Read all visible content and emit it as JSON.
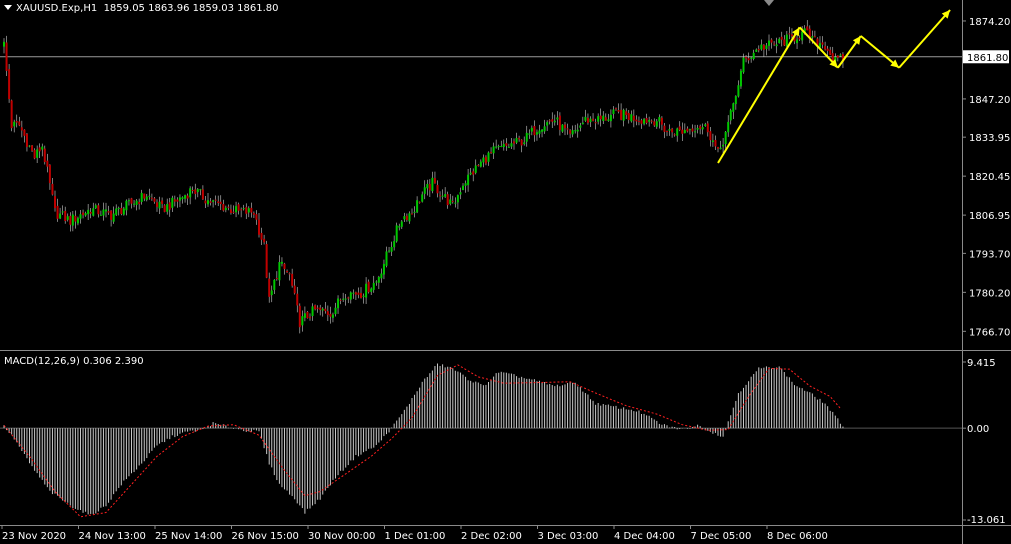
{
  "chart_header": {
    "symbol_text": "XAUUSD.Exp,H1",
    "ohlc_text": "1859.05 1863.96 1859.03 1861.80"
  },
  "macd_header": {
    "text": "MACD(12,26,9) 0.306 2.390"
  },
  "colors": {
    "background": "#000000",
    "bull_candle": "#00c800",
    "bear_candle": "#c00000",
    "wick": "#cfcfcf",
    "macd_hist": "#c8c8c8",
    "macd_signal": "#ff2020",
    "arrows": "#ffff00",
    "grid_line": "#8a8a8a"
  },
  "chart_data": [
    {
      "type": "candlestick",
      "symbol": "XAUUSD.Exp",
      "timeframe": "H1",
      "y_ticks": [
        "1874.20",
        "1861.80",
        "1847.20",
        "1833.95",
        "1820.45",
        "1806.95",
        "1793.70",
        "1780.20",
        "1766.70"
      ],
      "y_range": [
        1763,
        1878
      ],
      "current_price": 1861.8,
      "x_labels": [
        "23 Nov 2020",
        "24 Nov 13:00",
        "25 Nov 14:00",
        "26 Nov 15:00",
        "30 Nov 00:00",
        "1 Dec 01:00",
        "2 Dec 02:00",
        "3 Dec 03:00",
        "4 Dec 04:00",
        "7 Dec 05:00",
        "8 Dec 06:00"
      ],
      "close_path": [
        [
          0,
          1866
        ],
        [
          3,
          1838
        ],
        [
          6,
          1838
        ],
        [
          12,
          1827
        ],
        [
          15,
          1831
        ],
        [
          20,
          1808
        ],
        [
          26,
          1805
        ],
        [
          34,
          1809
        ],
        [
          42,
          1807
        ],
        [
          50,
          1811
        ],
        [
          56,
          1814
        ],
        [
          62,
          1809
        ],
        [
          68,
          1812
        ],
        [
          74,
          1816
        ],
        [
          80,
          1812
        ],
        [
          86,
          1810
        ],
        [
          92,
          1808
        ],
        [
          98,
          1808
        ],
        [
          102,
          1796
        ],
        [
          104,
          1777
        ],
        [
          108,
          1790
        ],
        [
          112,
          1786
        ],
        [
          116,
          1770
        ],
        [
          122,
          1774
        ],
        [
          128,
          1773
        ],
        [
          134,
          1780
        ],
        [
          140,
          1780
        ],
        [
          146,
          1784
        ],
        [
          152,
          1797
        ],
        [
          156,
          1806
        ],
        [
          160,
          1808
        ],
        [
          164,
          1814
        ],
        [
          168,
          1818
        ],
        [
          172,
          1814
        ],
        [
          176,
          1810
        ],
        [
          180,
          1818
        ],
        [
          184,
          1822
        ],
        [
          188,
          1826
        ],
        [
          192,
          1829
        ],
        [
          198,
          1831
        ],
        [
          204,
          1833
        ],
        [
          210,
          1838
        ],
        [
          216,
          1840
        ],
        [
          222,
          1834
        ],
        [
          228,
          1840
        ],
        [
          234,
          1840
        ],
        [
          240,
          1842
        ],
        [
          246,
          1841
        ],
        [
          252,
          1840
        ],
        [
          256,
          1840
        ],
        [
          260,
          1836
        ],
        [
          266,
          1836
        ],
        [
          272,
          1838
        ],
        [
          276,
          1837
        ],
        [
          280,
          1828
        ],
        [
          284,
          1838
        ],
        [
          290,
          1860
        ],
        [
          296,
          1865
        ],
        [
          302,
          1866
        ],
        [
          308,
          1868
        ],
        [
          314,
          1870
        ],
        [
          318,
          1867
        ],
        [
          322,
          1866
        ],
        [
          326,
          1860
        ],
        [
          329,
          1861
        ]
      ],
      "count": 330,
      "annotations": [
        {
          "type": "arrow",
          "color": "yellow",
          "points": [
            [
              1825,
              280
            ],
            [
              1872,
              312
            ]
          ]
        },
        {
          "type": "zigzag-arrows",
          "color": "yellow",
          "points": [
            [
              1872,
              312
            ],
            [
              1858,
              327
            ],
            [
              1869,
              336
            ],
            [
              1858,
              351
            ],
            [
              1878,
              371
            ]
          ]
        }
      ]
    },
    {
      "type": "macd",
      "name": "MACD(12,26,9)",
      "params": [
        12,
        26,
        9
      ],
      "macd_value": 0.306,
      "signal_value": 2.39,
      "y_ticks": [
        "9.415",
        "0.00",
        "-13.061"
      ],
      "y_range": [
        -13.061,
        9.415
      ],
      "hist_path": [
        [
          0,
          0.3
        ],
        [
          4,
          -1.5
        ],
        [
          10,
          -5
        ],
        [
          18,
          -9
        ],
        [
          26,
          -11
        ],
        [
          34,
          -12.4
        ],
        [
          40,
          -11
        ],
        [
          46,
          -8
        ],
        [
          54,
          -5
        ],
        [
          60,
          -2.5
        ],
        [
          66,
          -1.2
        ],
        [
          72,
          -0.5
        ],
        [
          78,
          -0.2
        ],
        [
          82,
          0.7
        ],
        [
          88,
          0.2
        ],
        [
          94,
          -0.3
        ],
        [
          100,
          -0.5
        ],
        [
          104,
          -5
        ],
        [
          108,
          -8
        ],
        [
          114,
          -10
        ],
        [
          118,
          -12
        ],
        [
          124,
          -10
        ],
        [
          130,
          -7
        ],
        [
          138,
          -4
        ],
        [
          146,
          -2.5
        ],
        [
          152,
          0
        ],
        [
          158,
          3
        ],
        [
          164,
          6.5
        ],
        [
          170,
          9.1
        ],
        [
          176,
          8.5
        ],
        [
          182,
          7
        ],
        [
          188,
          6
        ],
        [
          194,
          8
        ],
        [
          200,
          7.5
        ],
        [
          208,
          6.8
        ],
        [
          216,
          6
        ],
        [
          224,
          6.5
        ],
        [
          232,
          3.5
        ],
        [
          240,
          3
        ],
        [
          248,
          2.5
        ],
        [
          252,
          1.8
        ],
        [
          258,
          0.5
        ],
        [
          266,
          -0.2
        ],
        [
          272,
          0.4
        ],
        [
          276,
          -0.3
        ],
        [
          282,
          -1.2
        ],
        [
          288,
          5
        ],
        [
          296,
          8.5
        ],
        [
          304,
          8.8
        ],
        [
          310,
          6.2
        ],
        [
          316,
          5
        ],
        [
          322,
          3.5
        ],
        [
          329,
          0.3
        ]
      ],
      "signal_path": [
        [
          0,
          0.4
        ],
        [
          10,
          -4
        ],
        [
          20,
          -9
        ],
        [
          30,
          -12.6
        ],
        [
          40,
          -12
        ],
        [
          50,
          -8
        ],
        [
          60,
          -4
        ],
        [
          70,
          -1.2
        ],
        [
          80,
          0.3
        ],
        [
          90,
          0.5
        ],
        [
          100,
          -1
        ],
        [
          110,
          -6
        ],
        [
          118,
          -9.6
        ],
        [
          124,
          -9
        ],
        [
          134,
          -6.5
        ],
        [
          144,
          -4
        ],
        [
          152,
          -1.5
        ],
        [
          160,
          1.5
        ],
        [
          170,
          7.5
        ],
        [
          178,
          9
        ],
        [
          186,
          7.3
        ],
        [
          196,
          6.4
        ],
        [
          210,
          6.5
        ],
        [
          222,
          6.6
        ],
        [
          232,
          5
        ],
        [
          244,
          3.2
        ],
        [
          256,
          2
        ],
        [
          266,
          0.5
        ],
        [
          276,
          -0.3
        ],
        [
          284,
          -0.2
        ],
        [
          292,
          4.5
        ],
        [
          300,
          8.5
        ],
        [
          308,
          8.4
        ],
        [
          316,
          6
        ],
        [
          324,
          4.5
        ],
        [
          329,
          2.4
        ]
      ]
    }
  ]
}
